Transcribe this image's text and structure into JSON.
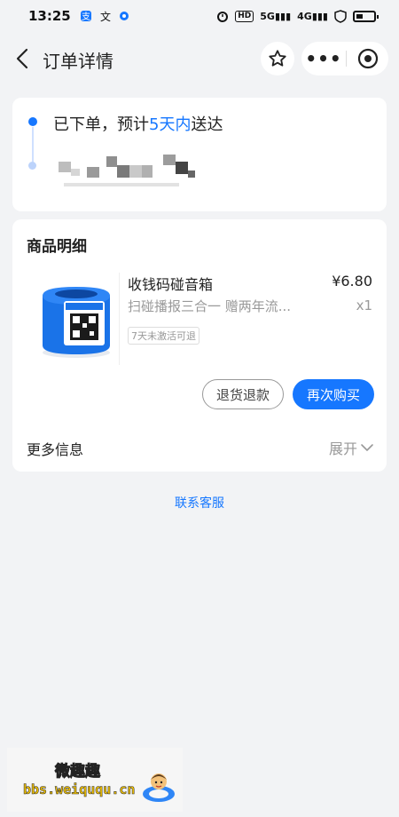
{
  "status_bar": {
    "time": "13:25",
    "app_icons": [
      "alipay-icon",
      "translate-icon",
      "settings-badge-icon"
    ],
    "right_icons": [
      "alarm-icon",
      "hd-icon",
      "signal-5g-icon",
      "signal-4g-icon",
      "shield-icon",
      "battery-icon"
    ],
    "hd_label": "HD",
    "net1_label": "5G",
    "net2_label": "4G"
  },
  "header": {
    "title": "订单详情",
    "more_label": "•••"
  },
  "order_status": {
    "prefix": "已下单，预计",
    "highlight": "5天内",
    "suffix": "送达",
    "accent_color": "#1677ff"
  },
  "goods": {
    "section_title": "商品明细",
    "product": {
      "name": "收钱码碰音箱",
      "price": "¥6.80",
      "description": "扫碰播报三合一  赠两年流...",
      "quantity": "x1",
      "policy_tag": "7天未激活可退"
    },
    "refund_button": "退货退款",
    "rebuy_button": "再次购买",
    "more_info_label": "更多信息",
    "expand_label": "展开"
  },
  "contact_link": "联系客服",
  "watermark": {
    "title": "微趣趣",
    "url": "bbs.weiququ.cn"
  }
}
